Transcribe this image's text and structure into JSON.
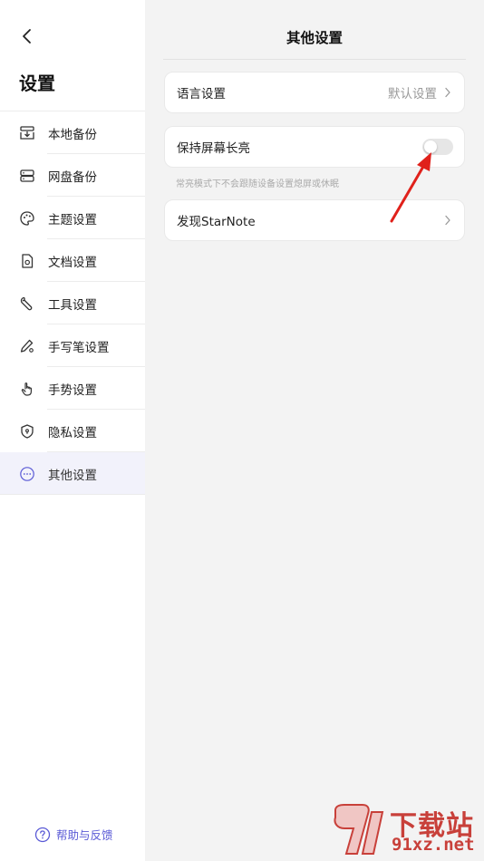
{
  "sidebar": {
    "title": "设置",
    "items": [
      {
        "label": "本地备份",
        "icon": "local-backup-icon"
      },
      {
        "label": "网盘备份",
        "icon": "cloud-drive-icon"
      },
      {
        "label": "主题设置",
        "icon": "palette-icon"
      },
      {
        "label": "文档设置",
        "icon": "document-gear-icon"
      },
      {
        "label": "工具设置",
        "icon": "wrench-icon"
      },
      {
        "label": "手写笔设置",
        "icon": "pen-gear-icon"
      },
      {
        "label": "手势设置",
        "icon": "hand-gesture-icon"
      },
      {
        "label": "隐私设置",
        "icon": "shield-icon"
      },
      {
        "label": "其他设置",
        "icon": "more-circle-icon",
        "active": true
      }
    ],
    "help_label": "帮助与反馈"
  },
  "main": {
    "title": "其他设置",
    "language": {
      "label": "语言设置",
      "value": "默认设置"
    },
    "screen": {
      "label": "保持屏幕长亮",
      "enabled": false,
      "hint": "常亮模式下不会跟随设备设置熄屏或休眠"
    },
    "discover": {
      "label": "发现StarNote"
    }
  },
  "watermark": {
    "line1": "下载站",
    "line2": "91xz.net"
  },
  "colors": {
    "accent": "#5a5ad6",
    "active_bg": "#f2f2fb",
    "arrow": "#e0211b",
    "watermark": "#c8403a"
  }
}
